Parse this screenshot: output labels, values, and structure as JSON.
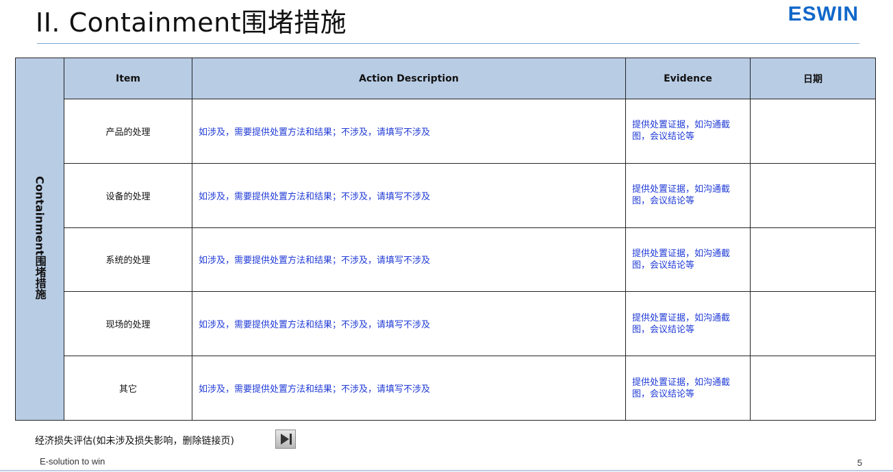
{
  "header": {
    "title": "II. Containment围堵措施",
    "logo": "ESWIN"
  },
  "table": {
    "side_label": "Containment围堵措施",
    "columns": [
      "Item",
      "Action Description",
      "Evidence",
      "日期"
    ],
    "rows": [
      {
        "item": "产品的处理",
        "action": "如涉及，需要提供处置方法和结果；不涉及，请填写不涉及",
        "evidence": "提供处置证据，如沟通截图，会议结论等",
        "date": ""
      },
      {
        "item": "设备的处理",
        "action": "如涉及，需要提供处置方法和结果；不涉及，请填写不涉及",
        "evidence": "提供处置证据，如沟通截图，会议结论等",
        "date": ""
      },
      {
        "item": "系统的处理",
        "action": "如涉及，需要提供处置方法和结果；不涉及，请填写不涉及",
        "evidence": "提供处置证据，如沟通截图，会议结论等",
        "date": ""
      },
      {
        "item": "现场的处理",
        "action": "如涉及，需要提供处置方法和结果；不涉及，请填写不涉及",
        "evidence": "提供处置证据，如沟通截图，会议结论等",
        "date": ""
      },
      {
        "item": "其它",
        "action": "如涉及，需要提供处置方法和结果；不涉及，请填写不涉及",
        "evidence": "提供处置证据，如沟通截图，会议结论等",
        "date": ""
      }
    ]
  },
  "footnote": "经济损失评估(如未涉及损失影响，删除链接页)",
  "next_button_icon": "next-slide-icon",
  "footer": {
    "slogan": "E-solution to win",
    "page_number": "5"
  }
}
